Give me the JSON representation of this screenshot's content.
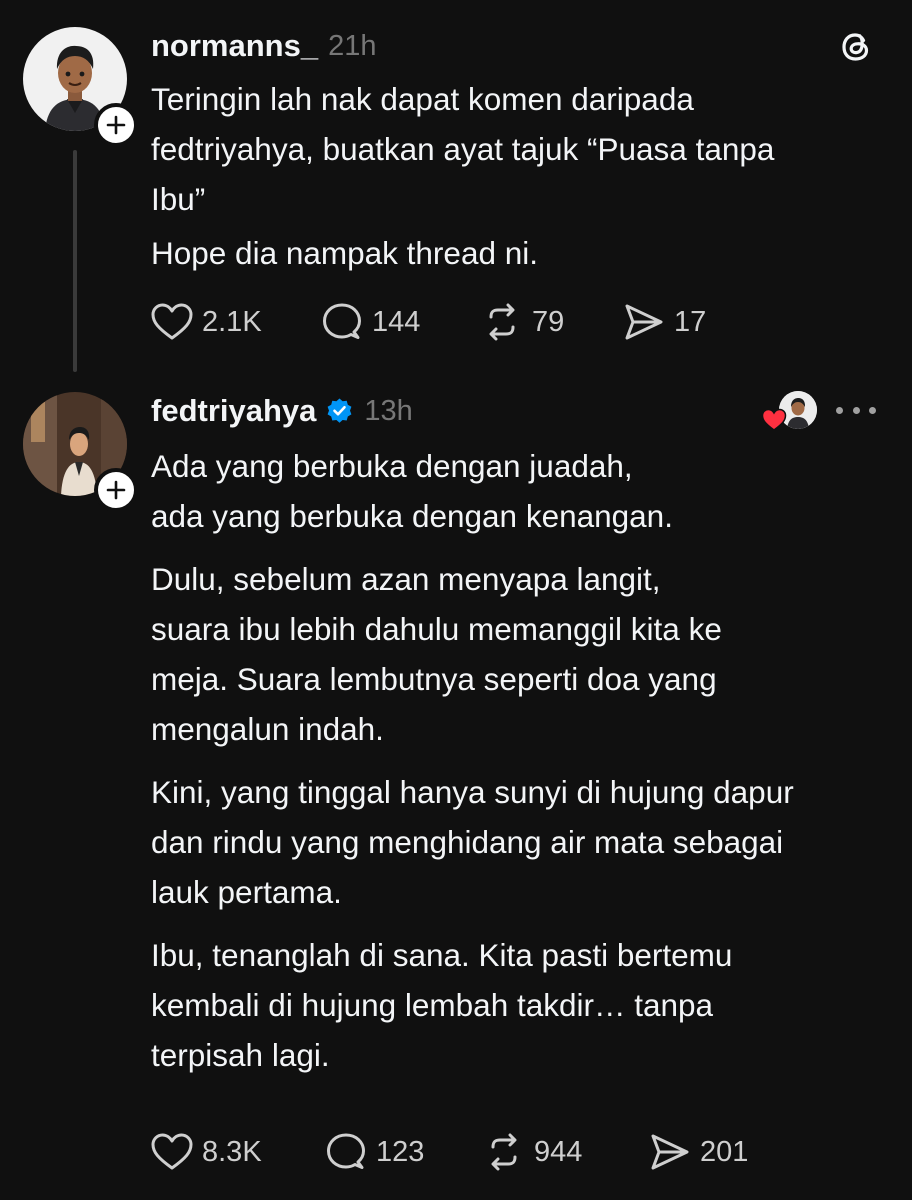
{
  "post": {
    "username": "normanns_",
    "time": "21h",
    "paragraphs": [
      "Teringin lah nak dapat komen daripada\nfedtriyahya, buatkan ayat tajuk “Puasa tanpa\nIbu”",
      "Hope dia nampak thread ni."
    ],
    "likes": "2.1K",
    "comments": "144",
    "reposts": "79",
    "shares": "17"
  },
  "reply": {
    "username": "fedtriyahya",
    "time": "13h",
    "paragraphs": [
      "Ada yang berbuka dengan juadah,\nada yang berbuka dengan kenangan.",
      "Dulu, sebelum azan menyapa langit,\nsuara ibu lebih dahulu memanggil kita ke\nmeja. Suara lembutnya seperti doa yang\nmengalun indah.",
      "Kini, yang tinggal hanya sunyi di hujung dapur\ndan rindu yang menghidang air mata sebagai\nlauk pertama.",
      "Ibu, tenanglah di sana. Kita pasti bertemu\nkembali di hujung lembah takdir… tanpa\nterpisah lagi."
    ],
    "likes": "8.3K",
    "comments": "123",
    "reposts": "944",
    "shares": "201"
  },
  "icons": {
    "app_logo": "threads-logo-icon",
    "follow": "plus-icon",
    "verified": "verified-badge-icon",
    "like": "heart-icon",
    "comment": "comment-bubble-icon",
    "repost": "repost-icon",
    "share": "share-send-icon",
    "more": "more-horizontal-icon"
  },
  "colors": {
    "background": "#101010",
    "text": "#f3f5f7",
    "muted": "#777777",
    "verified": "#0095f6",
    "liked_heart": "#ff3040"
  }
}
